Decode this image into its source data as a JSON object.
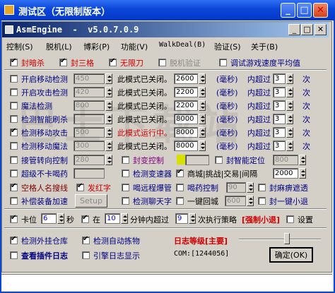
{
  "outer_window": {
    "title": "测试区（无限制版本）"
  },
  "inner_window": {
    "title": "AsmEngine  -  v5.0.7.0.9"
  },
  "menu": [
    "控制(S)",
    "脱机(L)",
    "博彩(P)",
    "功能(V)",
    "WalkDeal(B)",
    "脱机验证",
    "验证(S)",
    "关于(B)"
  ],
  "top_checks": [
    {
      "label": "封暗杀",
      "checked": true
    },
    {
      "label": "封三格",
      "checked": true
    },
    {
      "label": "无限刀",
      "checked": true
    },
    {
      "label": "脱机验证",
      "checked": false
    },
    {
      "label": "调试游戏速度平均值",
      "checked": false
    }
  ],
  "rows": [
    {
      "label": "开启移动检测",
      "value": "450",
      "status": "此模式已关闭。",
      "num": "2600",
      "unit": "(毫秒)",
      "desc": "内超过",
      "count": "3",
      "suffix": "次"
    },
    {
      "label": "开启攻击检测",
      "value": "420",
      "status": "此模式已关闭。",
      "num": "2200",
      "unit": "(毫秒)",
      "desc": "内超过",
      "count": "3",
      "suffix": "次"
    },
    {
      "label": "魔法检测",
      "value": "800",
      "status": "此模式已关闭。",
      "num": "2200",
      "unit": "(毫秒)",
      "desc": "内超过",
      "count": "3",
      "suffix": "次"
    },
    {
      "label": "检测智能刷杀",
      "value": "",
      "status": "此模式已关闭。",
      "num": "8000",
      "unit": "(毫秒)",
      "desc": "内超过",
      "count": "3",
      "suffix": "次"
    },
    {
      "label": "检测移动攻击",
      "value": "500",
      "status": "此模式运行中。",
      "num": "8000",
      "unit": "(毫秒)",
      "desc": "内超过",
      "count": "3",
      "suffix": "次"
    },
    {
      "label": "检测移动魔法",
      "value": "300",
      "status": "此模式已关闭。",
      "num": "8000",
      "unit": "(毫秒)",
      "desc": "内超过",
      "count": "3",
      "suffix": "次"
    }
  ],
  "rows2": {
    "r1": {
      "a": "接管转向控制",
      "a_val": "280",
      "b": "封变控制",
      "c": "封智能定位",
      "c_val": "800"
    },
    "r2": {
      "a": "超级不卡喝药",
      "b": "检测变速器",
      "c": "商城|挑战|交易|间隔",
      "c_val": "2000"
    },
    "r3": {
      "a": "空格人名搜线",
      "a2": "发红字",
      "b": "喝远程爆管",
      "c": "喝药控制",
      "c_val": "90",
      "d": "封麻痹遮透"
    },
    "r4": {
      "a": "补偿装备加速",
      "setup": "Setup",
      "b": "检测聊天字",
      "c": "一键回城",
      "c_val": "600",
      "d": "封一键小退"
    }
  },
  "timing": {
    "card_label": "卡位",
    "card_val": "6",
    "card_unit": "秒",
    "in_label": "在",
    "in_val": "10",
    "min_text": "分钟内超过",
    "times_val": "9",
    "times_text": "次执行策略",
    "policy": "[强制小退]",
    "setup_label": "设置"
  },
  "bottom": {
    "check1": "检测外挂仓库",
    "check2": "检测自动拣物",
    "check3": "查看插件日志",
    "check4": "引擎日志显示",
    "log_label": "日志等级[主要]",
    "com_text": "COM:[1244056]",
    "ok": "确定(OK)"
  },
  "watermark": "巴士下载站"
}
